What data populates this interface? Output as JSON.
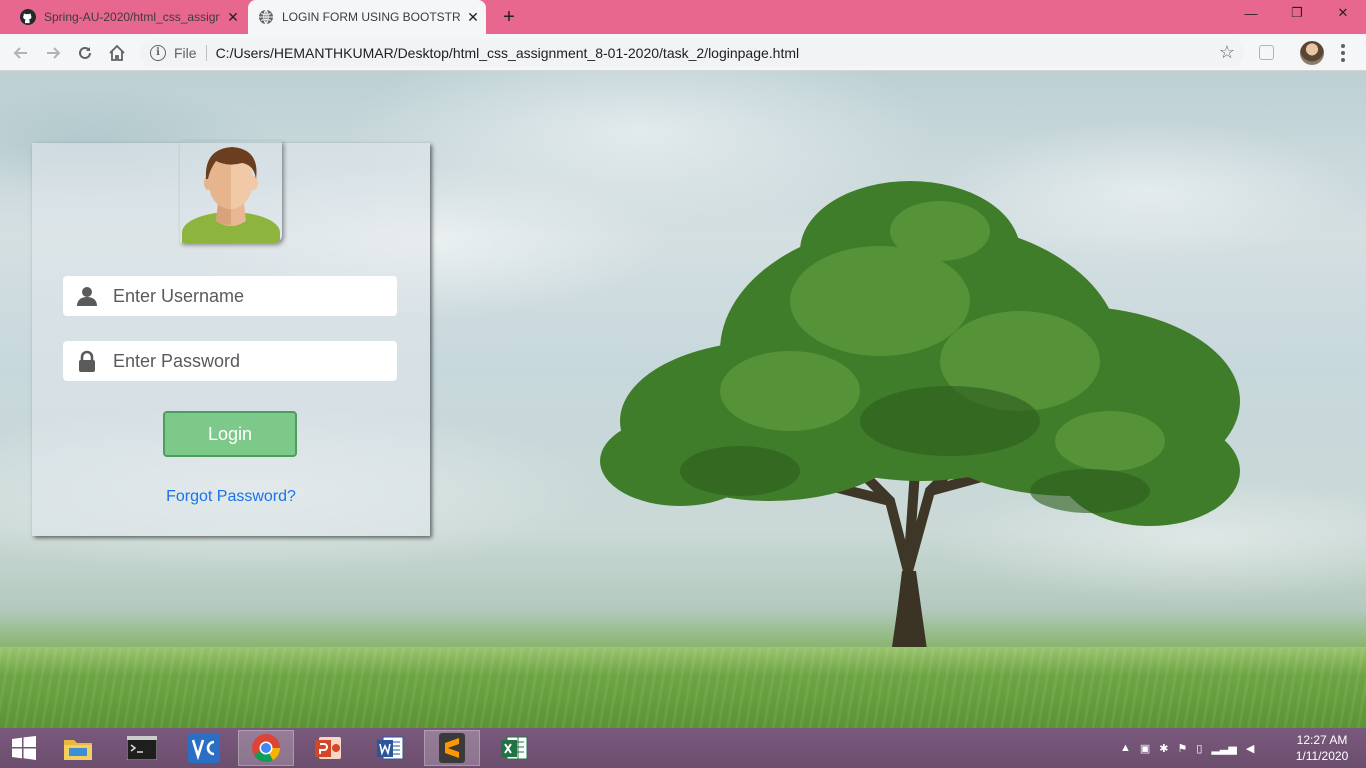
{
  "browser": {
    "tabs": [
      {
        "title": "Spring-AU-2020/html_css_assign",
        "icon": "github-icon"
      },
      {
        "title": "LOGIN FORM USING BOOTSTRAP",
        "icon": "globe-icon",
        "active": true
      }
    ],
    "address": {
      "scheme_label": "File",
      "url": "C:/Users/HEMANTHKUMAR/Desktop/html_css_assignment_8-01-2020/task_2/loginpage.html"
    }
  },
  "login": {
    "username_placeholder": "Enter Username",
    "password_placeholder": "Enter Password",
    "login_label": "Login",
    "forgot_label": "Forgot Password?",
    "colors": {
      "button": "#7dc98a",
      "link": "#1a73e8"
    }
  },
  "taskbar": {
    "apps": [
      "windows-start-icon",
      "file-explorer-icon",
      "terminal-icon",
      "vnc-icon",
      "chrome-icon",
      "powerpoint-icon",
      "word-icon",
      "sublime-text-icon",
      "excel-icon"
    ],
    "time": "12:27 AM",
    "date": "1/11/2020"
  }
}
